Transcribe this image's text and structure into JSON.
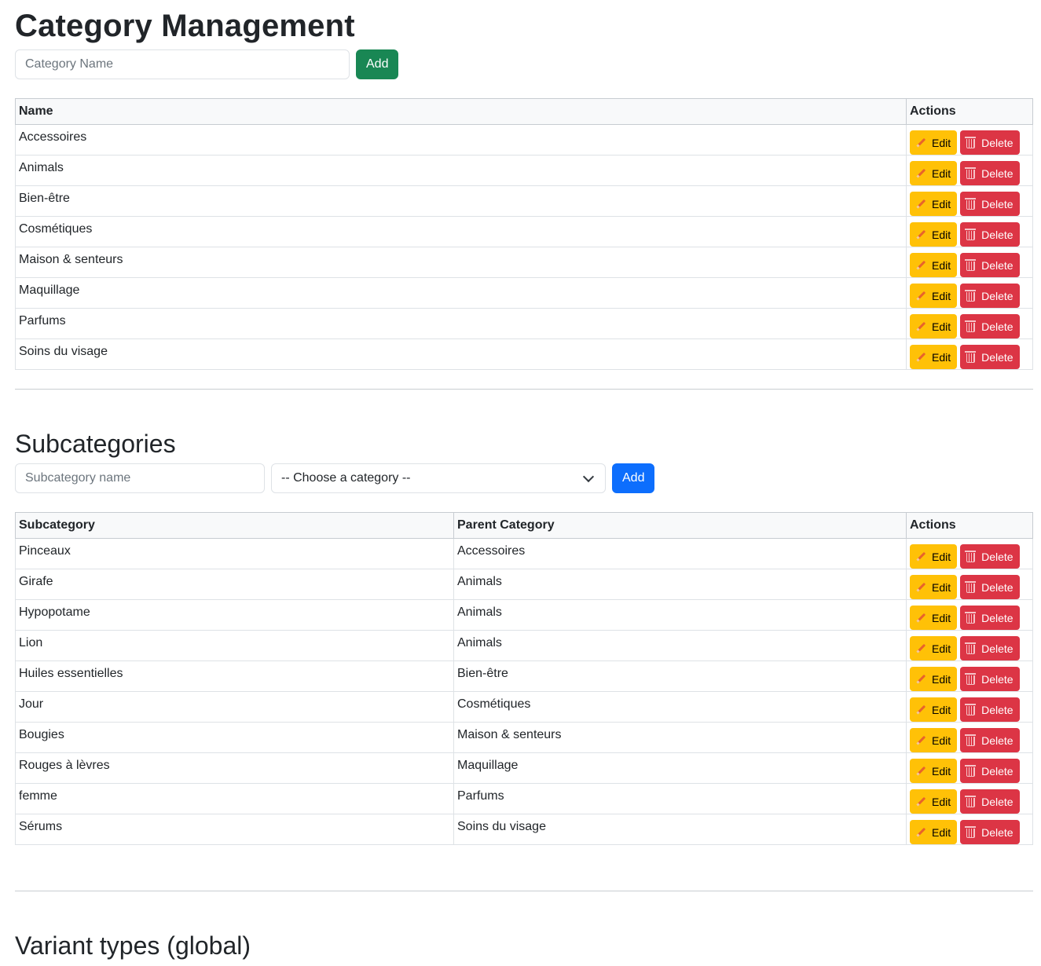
{
  "categories": {
    "title": "Category Management",
    "input_placeholder": "Category Name",
    "add_label": "Add",
    "headers": {
      "name": "Name",
      "actions": "Actions"
    },
    "rows": [
      "Accessoires",
      "Animals",
      "Bien-être",
      "Cosmétiques",
      "Maison & senteurs",
      "Maquillage",
      "Parfums",
      "Soins du visage"
    ]
  },
  "subcategories": {
    "title": "Subcategories",
    "input_placeholder": "Subcategory name",
    "select_value": "-- Choose a category --",
    "add_label": "Add",
    "headers": {
      "subcategory": "Subcategory",
      "parent": "Parent Category",
      "actions": "Actions"
    },
    "rows": [
      {
        "name": "Pinceaux",
        "parent": "Accessoires"
      },
      {
        "name": "Girafe",
        "parent": "Animals"
      },
      {
        "name": "Hypopotame",
        "parent": "Animals"
      },
      {
        "name": "Lion",
        "parent": "Animals"
      },
      {
        "name": "Huiles essentielles",
        "parent": "Bien-être"
      },
      {
        "name": "Jour",
        "parent": "Cosmétiques"
      },
      {
        "name": "Bougies",
        "parent": "Maison & senteurs"
      },
      {
        "name": "Rouges à lèvres",
        "parent": "Maquillage"
      },
      {
        "name": "femme",
        "parent": "Parfums"
      },
      {
        "name": "Sérums",
        "parent": "Soins du visage"
      }
    ]
  },
  "actions": {
    "edit_label": "Edit",
    "delete_label": "Delete",
    "edit_icon": "pencil-icon",
    "delete_icon": "trash-icon"
  },
  "variants": {
    "title": "Variant types (global)"
  },
  "colors": {
    "success": "#198754",
    "primary": "#0d6efd",
    "warning": "#ffc107",
    "danger": "#dc3545"
  }
}
